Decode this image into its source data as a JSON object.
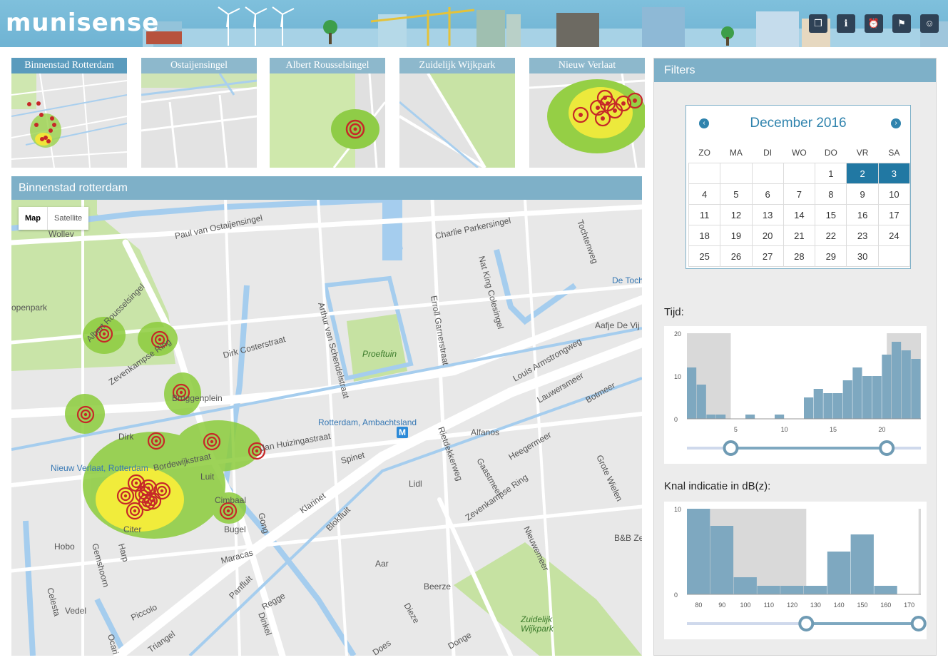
{
  "app": {
    "logo": "munisense"
  },
  "header_buttons": [
    {
      "name": "cube-icon",
      "glyph": "❒"
    },
    {
      "name": "info-icon",
      "glyph": "ℹ"
    },
    {
      "name": "alarm-icon",
      "glyph": "⏰"
    },
    {
      "name": "uk-flag-icon",
      "glyph": "⚑"
    },
    {
      "name": "user-icon",
      "glyph": "☺"
    }
  ],
  "thumbnails": [
    {
      "label": "Binnenstad Rotterdam",
      "active": true
    },
    {
      "label": "Ostaijensingel",
      "active": false
    },
    {
      "label": "Albert Rousselsingel",
      "active": false
    },
    {
      "label": "Zuidelijk Wijkpark",
      "active": false
    },
    {
      "label": "Nieuw Verlaat",
      "active": false
    }
  ],
  "map": {
    "title": "Binnenstad rotterdam",
    "map_type": {
      "map": "Map",
      "satellite": "Satellite"
    },
    "labels": [
      "Paul van Ostaijensingel",
      "Charlie Parkersingel",
      "Tochtenweg",
      "Nat King Colesingel",
      "Erroll Garnerstraat",
      "Arthur van Schendelstraat",
      "Proeftuin",
      "Dirk Costerstraat",
      "De Toch",
      "Aafje De Vij",
      "Louis Armstrongweg",
      "Lauwersmeer",
      "Botmeer",
      "Rotterdam, Ambachtsland",
      "Alfanos",
      "Rietdekkerweg",
      "Gaastmeer",
      "Heegermeer",
      "Spinet",
      "Lidl",
      "Zevenkampse Ring",
      "Grote Wielen",
      "Nieuwemeer",
      "Klarinet",
      "Blokfluit",
      "B&B Ze",
      "Aar",
      "Beerze",
      "Diezе",
      "Zuidelijk",
      "Wijkpark",
      "Donge",
      "Regge",
      "Panfluit",
      "Dinkel",
      "Maracas",
      "Bugel",
      "Gong",
      "Luit",
      "Cimbaal",
      "Citer",
      "Harp",
      "Gemshoorn",
      "Hobo",
      "Celesta",
      "Vedel",
      "Piccolo",
      "Triangel",
      "Ocari",
      "Does",
      "Wollev",
      "openpark",
      "Nieuw Verlaat, Rotterdam",
      "Dirk",
      "Jan Huizingastraat",
      "Bordewijkstraat",
      "Bruggenplein",
      "Zevenkampse Ring",
      "Albert Rousselsingel",
      "M"
    ]
  },
  "filters": {
    "title": "Filters",
    "calendar": {
      "month": "December 2016",
      "prev": "‹",
      "next": "›",
      "weekdays": [
        "ZO",
        "MA",
        "DI",
        "WO",
        "DO",
        "VR",
        "SA"
      ],
      "weeks": [
        [
          "",
          "",
          "",
          "",
          "1",
          "2",
          "3"
        ],
        [
          "4",
          "5",
          "6",
          "7",
          "8",
          "9",
          "10"
        ],
        [
          "11",
          "12",
          "13",
          "14",
          "15",
          "16",
          "17"
        ],
        [
          "18",
          "19",
          "20",
          "21",
          "22",
          "23",
          "24"
        ],
        [
          "25",
          "26",
          "27",
          "28",
          "29",
          "30",
          ""
        ]
      ],
      "selected_days": [
        "2",
        "3"
      ]
    },
    "tijd": {
      "label": "Tijd:",
      "bin_start": 0,
      "bin_width": 1,
      "x_ticks": [
        "5",
        "10",
        "15",
        "20"
      ],
      "y_ticks": [
        "0",
        "10",
        "20"
      ],
      "xlim": [
        0,
        24
      ],
      "ylim": [
        0,
        20
      ],
      "values": [
        12,
        8,
        1,
        1,
        0,
        0,
        1,
        0,
        0,
        1,
        0,
        0,
        5,
        7,
        6,
        6,
        9,
        12,
        10,
        10,
        15,
        18,
        16,
        14
      ],
      "range": [
        4.5,
        20.5
      ]
    },
    "knal": {
      "label": "Knal indicatie in dB(z):",
      "bin_start": 75,
      "bin_width": 10,
      "x_ticks": [
        "80",
        "90",
        "100",
        "110",
        "120",
        "130",
        "140",
        "150",
        "160",
        "170"
      ],
      "y_ticks": [
        "0",
        "10"
      ],
      "xlim": [
        75,
        175
      ],
      "ylim": [
        0,
        10
      ],
      "values": [
        12,
        8,
        2,
        1,
        1,
        1,
        5,
        7,
        1,
        0
      ],
      "range": [
        126,
        174
      ]
    },
    "histogram_color": "#7ea8c0",
    "excluded_color": "#d9d9d9"
  }
}
